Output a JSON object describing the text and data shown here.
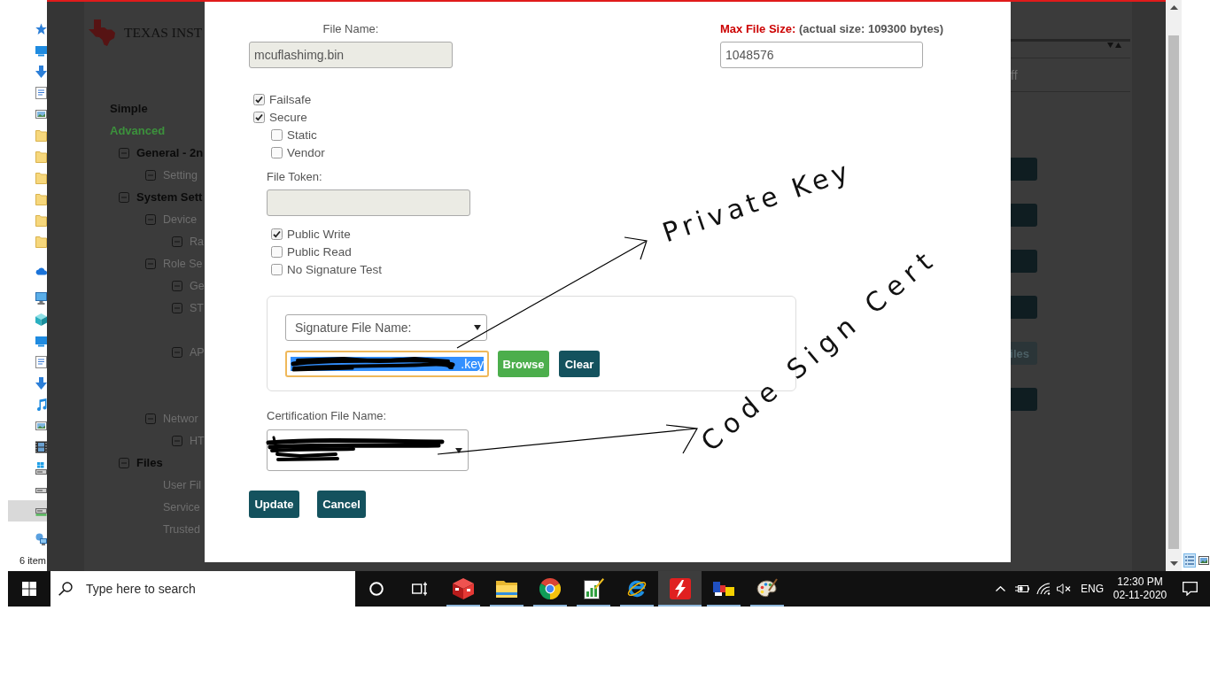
{
  "explorer_nav": {
    "groups": [
      {
        "items": [
          {
            "kind": "star",
            "selected": false
          },
          {
            "kind": "desktop",
            "selected": false
          },
          {
            "kind": "download",
            "selected": false
          },
          {
            "kind": "document",
            "selected": false
          },
          {
            "kind": "picture",
            "selected": false
          },
          {
            "kind": "folder",
            "selected": false
          },
          {
            "kind": "folder",
            "selected": false
          },
          {
            "kind": "folder",
            "selected": false
          },
          {
            "kind": "folder",
            "selected": false
          },
          {
            "kind": "folder",
            "selected": false
          },
          {
            "kind": "folder",
            "selected": false
          }
        ]
      },
      {
        "items": [
          {
            "kind": "cloud",
            "selected": false
          }
        ]
      },
      {
        "items": [
          {
            "kind": "computer",
            "selected": false
          },
          {
            "kind": "cube",
            "selected": false
          },
          {
            "kind": "desktop",
            "selected": false
          },
          {
            "kind": "document",
            "selected": false
          },
          {
            "kind": "download",
            "selected": false
          },
          {
            "kind": "music",
            "selected": false
          },
          {
            "kind": "picture",
            "selected": false
          },
          {
            "kind": "video",
            "selected": false
          },
          {
            "kind": "system_drive",
            "selected": false
          },
          {
            "kind": "drive",
            "selected": false
          },
          {
            "kind": "usb_drive",
            "selected": true
          }
        ]
      },
      {
        "items": [
          {
            "kind": "network",
            "selected": false
          }
        ]
      }
    ],
    "status": "6 item"
  },
  "background_page": {
    "logo_text": "TEXAS INST",
    "modes": [
      {
        "label": "Simple",
        "selected": false
      },
      {
        "label": "Advanced",
        "selected": true
      }
    ],
    "tree": [
      {
        "label": "General - 2n",
        "expanded": true,
        "children": [
          {
            "label": "Setting",
            "expanded": true
          }
        ]
      },
      {
        "label": "System Sett",
        "expanded": true,
        "children": [
          {
            "label": "Device",
            "expanded": true,
            "children": [
              {
                "label": "Ra",
                "expanded": true
              }
            ]
          },
          {
            "label": "Role Se",
            "expanded": true,
            "children": [
              {
                "label": "Ge",
                "expanded": true
              },
              {
                "label": "ST",
                "expanded": true
              },
              {
                "label": "AP",
                "expanded": true
              }
            ]
          },
          {
            "label": "Networ",
            "expanded": true,
            "children": [
              {
                "label": "HT",
                "expanded": true
              }
            ]
          }
        ]
      },
      {
        "label": "Files",
        "expanded": true,
        "children": [
          {
            "label": "User Fil"
          },
          {
            "label": "Service"
          },
          {
            "label": "Trusted"
          }
        ]
      }
    ],
    "table": {
      "cell": "ff"
    },
    "side_buttons": [
      {
        "disabled": false
      },
      {
        "disabled": false
      },
      {
        "disabled": false
      },
      {
        "disabled": false
      },
      {
        "label": "iles",
        "disabled": true
      },
      {
        "disabled": false
      }
    ]
  },
  "dialog": {
    "file_name": {
      "label": "File Name:",
      "value": "mcuflashimg.bin",
      "disabled": true
    },
    "max_file_size": {
      "label": "Max File Size:",
      "note": "(actual size: 109300 bytes)",
      "value": "1048576"
    },
    "flags": [
      {
        "label": "Failsafe",
        "checked": true
      },
      {
        "label": "Secure",
        "checked": true
      }
    ],
    "secure_options": {
      "flags": [
        {
          "label": "Static",
          "checked": false
        },
        {
          "label": "Vendor",
          "checked": false
        }
      ],
      "file_token": {
        "label": "File Token:",
        "disabled": true
      },
      "permissions": [
        {
          "label": "Public Write",
          "checked": true
        },
        {
          "label": "Public Read",
          "checked": false
        },
        {
          "label": "No Signature Test",
          "checked": false
        }
      ],
      "signature": {
        "select_value": "Signature File Name:",
        "key_file": {
          "value": ".key",
          "focused": true,
          "text_selected": true,
          "redacted": true
        },
        "buttons": [
          {
            "label": "Browse",
            "kind": "success"
          },
          {
            "label": "Clear",
            "kind": "default"
          }
        ]
      },
      "certification": {
        "label": "Certification File Name:",
        "redacted": true
      }
    },
    "buttons": [
      {
        "label": "Update",
        "kind": "default"
      },
      {
        "label": "Cancel",
        "kind": "default"
      }
    ]
  },
  "annotations": [
    {
      "text": "Private Key"
    },
    {
      "text": "Code Sign Cert"
    }
  ],
  "explorer_views": [
    {
      "kind": "details",
      "selected": true
    },
    {
      "kind": "thumbnails",
      "selected": false
    }
  ],
  "taskbar": {
    "search": {
      "placeholder": "Type here to search"
    },
    "apps": [
      {
        "kind": "cube",
        "running": true,
        "active": false
      },
      {
        "kind": "folder",
        "running": true,
        "active": false
      },
      {
        "kind": "browser",
        "running": true,
        "active": false
      },
      {
        "kind": "chart_document",
        "running": true,
        "active": false
      },
      {
        "kind": "web",
        "running": true,
        "active": false
      },
      {
        "kind": "lightning",
        "running": true,
        "active": true
      },
      {
        "kind": "blocks",
        "running": true,
        "active": false
      },
      {
        "kind": "palette",
        "running": true,
        "active": false
      }
    ],
    "tray": {
      "muted": true,
      "language": "ENG",
      "time": "12:30 PM",
      "date": "02-11-2020"
    }
  }
}
